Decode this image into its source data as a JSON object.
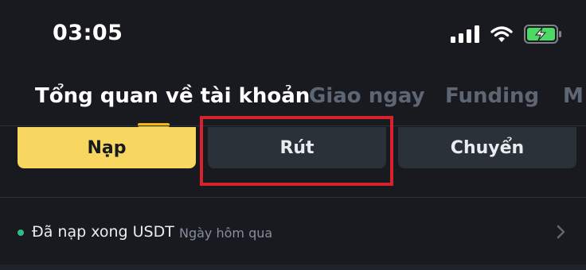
{
  "status_bar": {
    "time": "03:05",
    "icons": [
      "signal-icon",
      "wifi-icon",
      "battery-charging-icon"
    ]
  },
  "tabs": [
    {
      "label": "Tổng quan về tài khoản",
      "active": true
    },
    {
      "label": "Giao ngay",
      "active": false
    },
    {
      "label": "Funding",
      "active": false
    },
    {
      "label": "M",
      "active": false
    }
  ],
  "actions": {
    "deposit": "Nạp",
    "withdraw": "Rút",
    "transfer": "Chuyển"
  },
  "notice": {
    "text": "Đã nạp xong USDT",
    "time": "Ngày hôm qua"
  },
  "colors": {
    "background": "#181a20",
    "accent": "#f7d760",
    "highlight": "#d7212c",
    "status_dot": "#2ebd85"
  }
}
